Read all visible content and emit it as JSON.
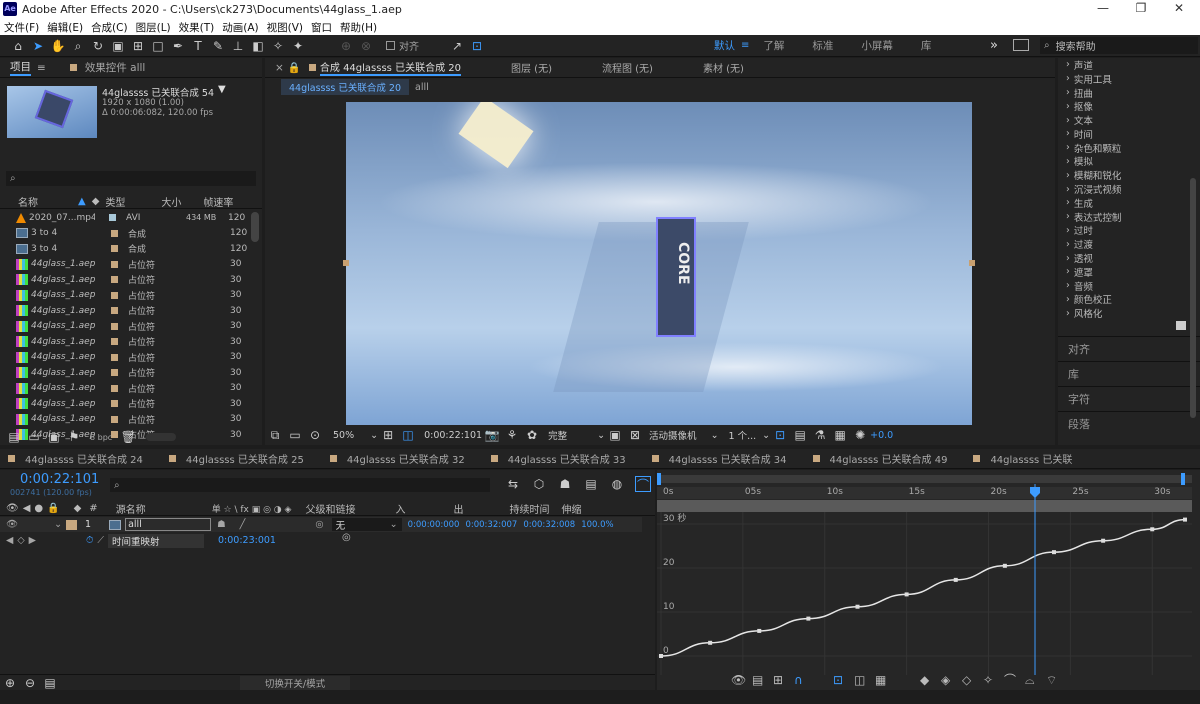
{
  "window": {
    "title": "Adobe After Effects 2020 - C:\\Users\\ck273\\Documents\\44glass_1.aep",
    "logo": "Ae",
    "minimize": "—",
    "maximize": "❐",
    "close": "✕"
  },
  "menu": [
    "文件(F)",
    "编辑(E)",
    "合成(C)",
    "图层(L)",
    "效果(T)",
    "动画(A)",
    "视图(V)",
    "窗口",
    "帮助(H)"
  ],
  "toolbar": {
    "align_label": "对齐",
    "workspaces": [
      "默认",
      "了解",
      "标准",
      "小屏幕",
      "库"
    ],
    "search_placeholder": "搜索帮助",
    "more": "»"
  },
  "project": {
    "tab": "项目",
    "effects_tab": "效果控件 alll",
    "item_name": "44glassss 已关联合成 54",
    "item_size": "1920 x 1080 (1.00)",
    "item_duration": "Δ 0:00:06:082, 120.00 fps",
    "search_icon": "⌕",
    "columns": {
      "name": "名称",
      "type": "类型",
      "size": "大小",
      "fps": "帧速率"
    },
    "rows": [
      {
        "icon": "vlc",
        "name": "2020_07...mp4",
        "color": "#a8c8d8",
        "type": "AVI",
        "size": "434 MB",
        "fps": "120"
      },
      {
        "icon": "comp",
        "name": "3 to 4",
        "color": "#c8a880",
        "type": "合成",
        "size": "",
        "fps": "120"
      },
      {
        "icon": "comp",
        "name": "3 to 4",
        "color": "#c8a880",
        "type": "合成",
        "size": "",
        "fps": "120"
      },
      {
        "icon": "ph",
        "name": "44glass_1.aep",
        "color": "#c8a880",
        "type": "占位符",
        "size": "",
        "fps": "30"
      },
      {
        "icon": "ph",
        "name": "44glass_1.aep",
        "color": "#c8a880",
        "type": "占位符",
        "size": "",
        "fps": "30"
      },
      {
        "icon": "ph",
        "name": "44glass_1.aep",
        "color": "#c8a880",
        "type": "占位符",
        "size": "",
        "fps": "30"
      },
      {
        "icon": "ph",
        "name": "44glass_1.aep",
        "color": "#c8a880",
        "type": "占位符",
        "size": "",
        "fps": "30"
      },
      {
        "icon": "ph",
        "name": "44glass_1.aep",
        "color": "#c8a880",
        "type": "占位符",
        "size": "",
        "fps": "30"
      },
      {
        "icon": "ph",
        "name": "44glass_1.aep",
        "color": "#c8a880",
        "type": "占位符",
        "size": "",
        "fps": "30"
      },
      {
        "icon": "ph",
        "name": "44glass_1.aep",
        "color": "#c8a880",
        "type": "占位符",
        "size": "",
        "fps": "30"
      },
      {
        "icon": "ph",
        "name": "44glass_1.aep",
        "color": "#c8a880",
        "type": "占位符",
        "size": "",
        "fps": "30"
      },
      {
        "icon": "ph",
        "name": "44glass_1.aep",
        "color": "#c8a880",
        "type": "占位符",
        "size": "",
        "fps": "30"
      },
      {
        "icon": "ph",
        "name": "44glass_1.aep",
        "color": "#c8a880",
        "type": "占位符",
        "size": "",
        "fps": "30"
      },
      {
        "icon": "ph",
        "name": "44glass_1.aep",
        "color": "#c8a880",
        "type": "占位符",
        "size": "",
        "fps": "30"
      },
      {
        "icon": "ph",
        "name": "44glass_1.aep",
        "color": "#c8a880",
        "type": "占位符",
        "size": "",
        "fps": "30"
      }
    ],
    "bpc": "8 bpc"
  },
  "viewer": {
    "tabs": [
      "合成 44glassss 已关联合成 20",
      "图层 (无)",
      "流程图 (无)",
      "素材 (无)"
    ],
    "active_comp": "44glassss 已关联合成 20",
    "sub_tabs": [
      "44glassss 已关联合成 20",
      "alll"
    ],
    "scene_text": "CORE",
    "controls": {
      "zoom": "50%",
      "time": "0:00:22:101",
      "resolution": "完整",
      "camera": "活动摄像机",
      "views": "1 个...",
      "exposure": "+0.0"
    }
  },
  "effects": {
    "categories": [
      "声道",
      "实用工具",
      "扭曲",
      "抠像",
      "文本",
      "时间",
      "杂色和颗粒",
      "模拟",
      "模糊和锐化",
      "沉浸式视频",
      "生成",
      "表达式控制",
      "过时",
      "过渡",
      "透视",
      "遮罩",
      "音频",
      "颜色校正",
      "风格化"
    ],
    "sections": [
      "对齐",
      "库",
      "字符",
      "段落"
    ]
  },
  "timeline": {
    "tabs": [
      "44glassss 已关联合成 24",
      "44glassss 已关联合成 25",
      "44glassss 已关联合成 32",
      "44glassss 已关联合成 33",
      "44glassss 已关联合成 34",
      "44glassss 已关联合成 49",
      "44glassss 已关联"
    ],
    "current_time": "0:00:22:101",
    "frame_info": "002741 (120.00 fps)",
    "search_placeholder": "⌕",
    "columns": {
      "num": "#",
      "source": "源名称",
      "switches": "单 ☆ \\ fx ▣ ◎ ◑ ◈",
      "parent": "父级和链接",
      "in": "入",
      "out": "出",
      "duration": "持续时间",
      "stretch": "伸缩"
    },
    "layer": {
      "num": "1",
      "name": "alll",
      "parent": "无",
      "in": "0:00:00:000",
      "out": "0:00:32:007",
      "duration": "0:00:32:008",
      "stretch": "100.0%"
    },
    "property": {
      "name": "时间重映射",
      "value": "0:00:23:001"
    },
    "toggle_label": "切换开关/模式",
    "ruler": [
      "0s",
      "05s",
      "10s",
      "15s",
      "20s",
      "25s",
      "30s"
    ],
    "graph_unit": "30 秒",
    "graph_y_labels": [
      "30",
      "20",
      "10",
      "0"
    ]
  },
  "chart_data": {
    "type": "line",
    "title": "",
    "xlabel": "",
    "ylabel": "",
    "x_unit": "s",
    "y_unit": "秒",
    "xlim": [
      0,
      32
    ],
    "ylim": [
      0,
      30
    ],
    "playhead": 22.84,
    "x": [
      0,
      3,
      6,
      9,
      12,
      15,
      18,
      21,
      24,
      27,
      30,
      32
    ],
    "y": [
      0,
      3,
      5.7,
      8.5,
      11.2,
      14,
      17.3,
      20.5,
      23.6,
      26.2,
      28.8,
      31
    ]
  }
}
